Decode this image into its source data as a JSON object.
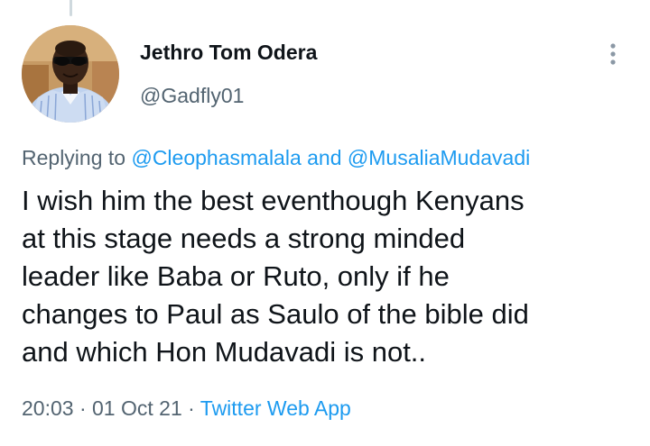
{
  "tweet": {
    "author": {
      "display_name": "Jethro Tom Odera",
      "handle": "@Gadfly01"
    },
    "reply": {
      "prefix": "Replying to",
      "mention_1": "@Cleophasmalala",
      "connector": "and",
      "mention_2": "@MusaliaMudavadi"
    },
    "text_lines": [
      "I wish him the best eventhough Kenyans",
      "at this stage needs a strong minded",
      "leader like Baba or Ruto, only if he",
      "changes to Paul as Saulo of the bible did",
      "and which Hon Mudavadi is not.."
    ],
    "meta": {
      "time": "20:03",
      "separator": "·",
      "date": "01 Oct 21",
      "source": "Twitter Web App"
    }
  },
  "icons": {
    "more": "more-vertical-icon",
    "avatar": "profile-photo"
  },
  "colors": {
    "link": "#1d9bf0",
    "secondary_text": "#536471",
    "primary_text": "#0f1419",
    "thread_line": "#cfd9de"
  }
}
